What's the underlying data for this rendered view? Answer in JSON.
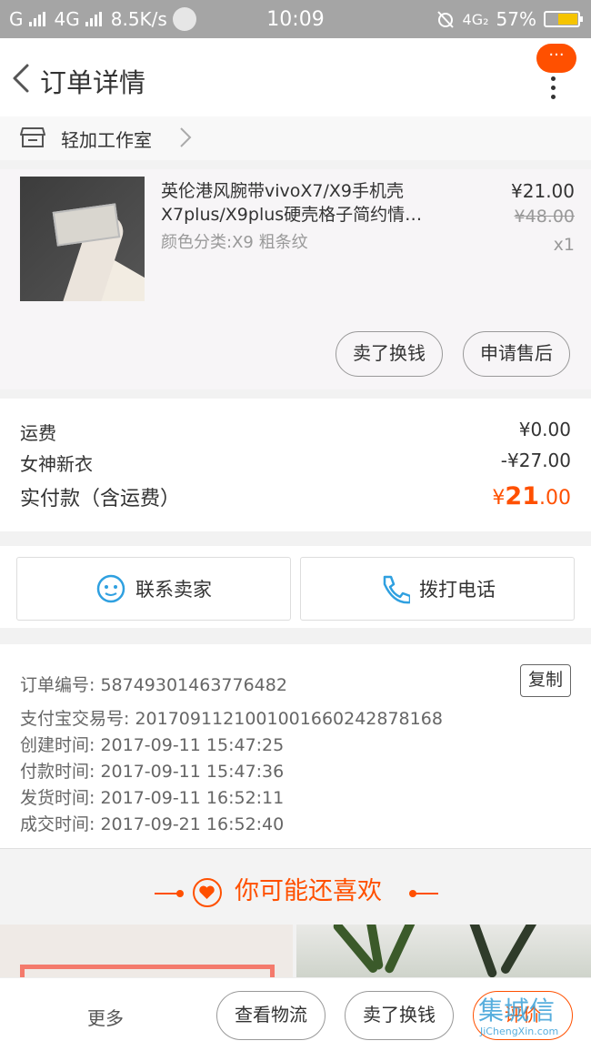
{
  "status_bar": {
    "carrier": "G",
    "network": "4G",
    "speed": "8.5K/s",
    "time": "10:09",
    "network_right": "4G₂",
    "battery": "57%",
    "battery_level": 0.57
  },
  "header": {
    "title": "订单详情",
    "message_badge": "···"
  },
  "shop": {
    "name": "轻加工作室"
  },
  "product": {
    "title_line1": "英伦港风腕带vivoX7/X9手机壳",
    "title_line2": "X7plus/X9plus硬壳格子简约情…",
    "sku": "颜色分类:X9  粗条纹",
    "price": "¥21.00",
    "original_price": "¥48.00",
    "quantity": "x1",
    "actions": {
      "resell": "卖了换钱",
      "after_sale": "申请售后"
    }
  },
  "fees": {
    "shipping_label": "运费",
    "shipping_value": "¥0.00",
    "discount_label": "女神新衣",
    "discount_value": "-¥27.00",
    "paid_label": "实付款（含运费）",
    "paid_currency": "¥",
    "paid_int": "21",
    "paid_dec": ".00"
  },
  "contact": {
    "seller": "联系卖家",
    "phone": "拨打电话"
  },
  "order_info": {
    "order_no": "订单编号: 58749301463776482",
    "copy": "复制",
    "alipay_no": "支付宝交易号: 2017091121001001660242878168",
    "created": "创建时间: 2017-09-11 15:47:25",
    "paid": "付款时间: 2017-09-11 15:47:36",
    "shipped": "发货时间: 2017-09-11 16:52:11",
    "completed": "成交时间: 2017-09-21 16:52:40"
  },
  "recommend": {
    "title": "你可能还喜欢"
  },
  "bottom_bar": {
    "more": "更多",
    "logistics": "查看物流",
    "resell": "卖了换钱",
    "review": "评价"
  },
  "watermark": {
    "cn": "集城信",
    "en": "JiChengXin.com"
  },
  "colors": {
    "accent": "#ff5000",
    "status_bar": "#a5a5a5",
    "battery": "#f5c400"
  }
}
